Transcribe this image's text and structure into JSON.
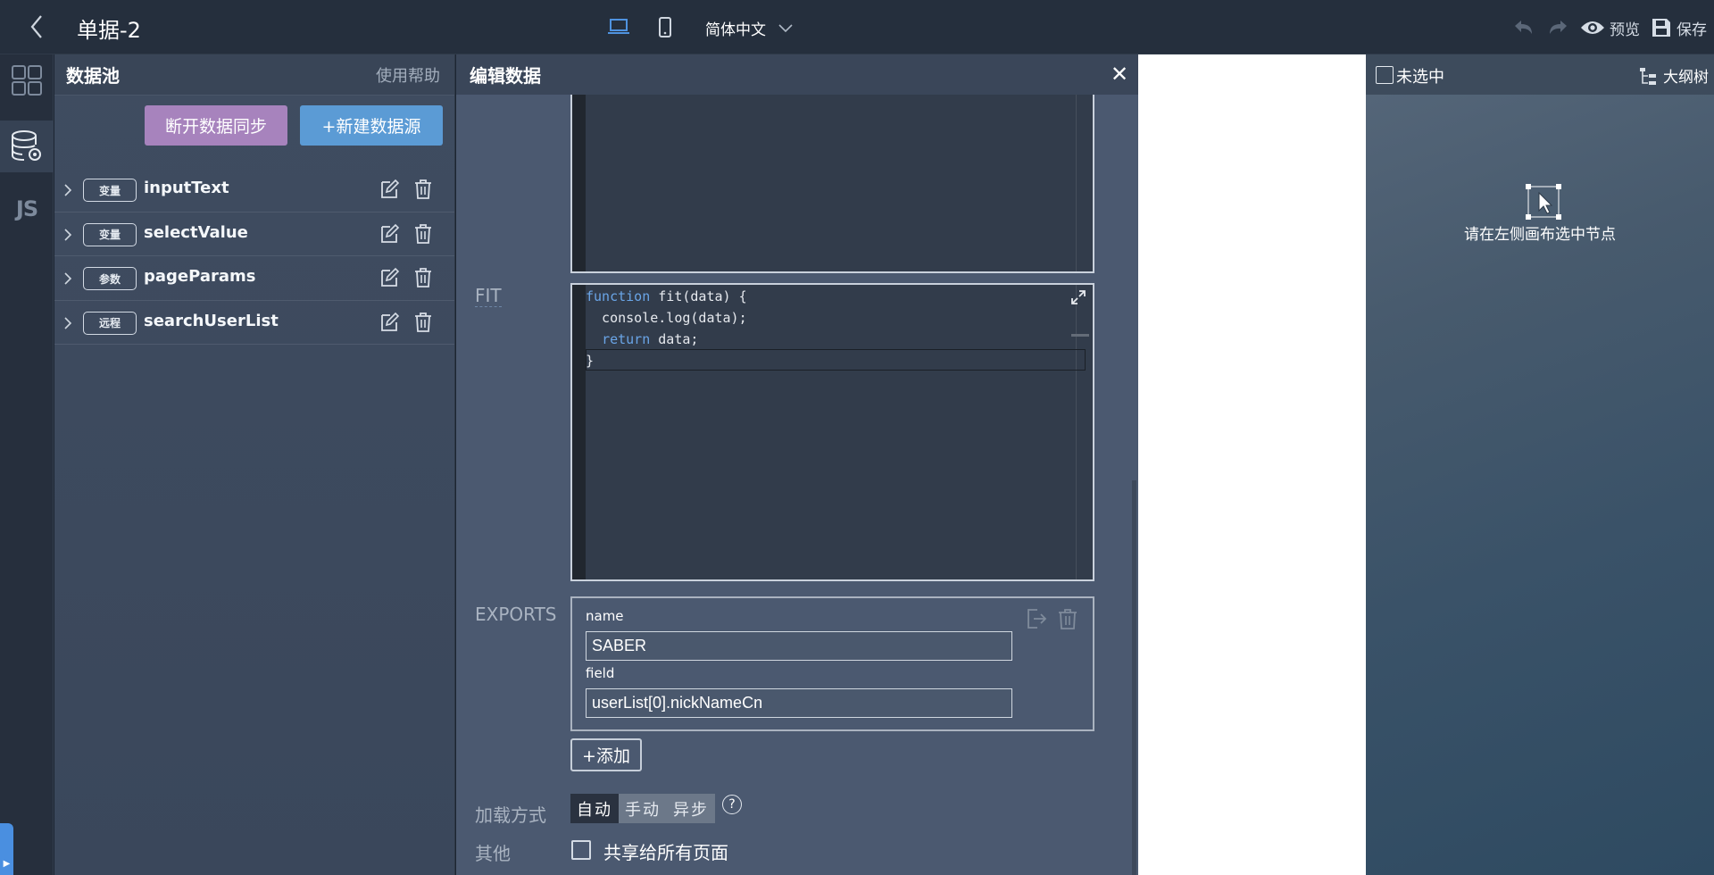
{
  "topbar": {
    "title": "单据-2",
    "language": "简体中文",
    "preview_label": "预览",
    "save_label": "保存"
  },
  "pool": {
    "title": "数据池",
    "help": "使用帮助",
    "disconnect_label": "断开数据同步",
    "new_source_label": "+新建数据源",
    "items": [
      {
        "badge": "变量",
        "name": "inputText"
      },
      {
        "badge": "变量",
        "name": "selectValue"
      },
      {
        "badge": "参数",
        "name": "pageParams"
      },
      {
        "badge": "远程",
        "name": "searchUserList"
      }
    ]
  },
  "editor": {
    "title": "编辑数据",
    "fit_label": "FIT",
    "fit_code": [
      "function fit(data) {",
      "  console.log(data);",
      "  return data;",
      "}"
    ],
    "exports_label": "EXPORTS",
    "export_name_label": "name",
    "export_name_value": "SABER",
    "export_field_label": "field",
    "export_field_value": "userList[0].nickNameCn",
    "add_label": "+添加",
    "load_mode_label": "加载方式",
    "load_modes": [
      "自动",
      "手动",
      "异步"
    ],
    "load_mode_selected": "自动",
    "help_glyph": "?",
    "other_label": "其他",
    "share_label": "共享给所有页面"
  },
  "right_panel": {
    "selection_label": "未选中",
    "outline_label": "大纲树",
    "hint": "请在左侧画布选中节点"
  },
  "colors": {
    "accent_blue": "#5b9bd5",
    "purple": "#a783bd",
    "keyword": "#6aa5e7"
  }
}
